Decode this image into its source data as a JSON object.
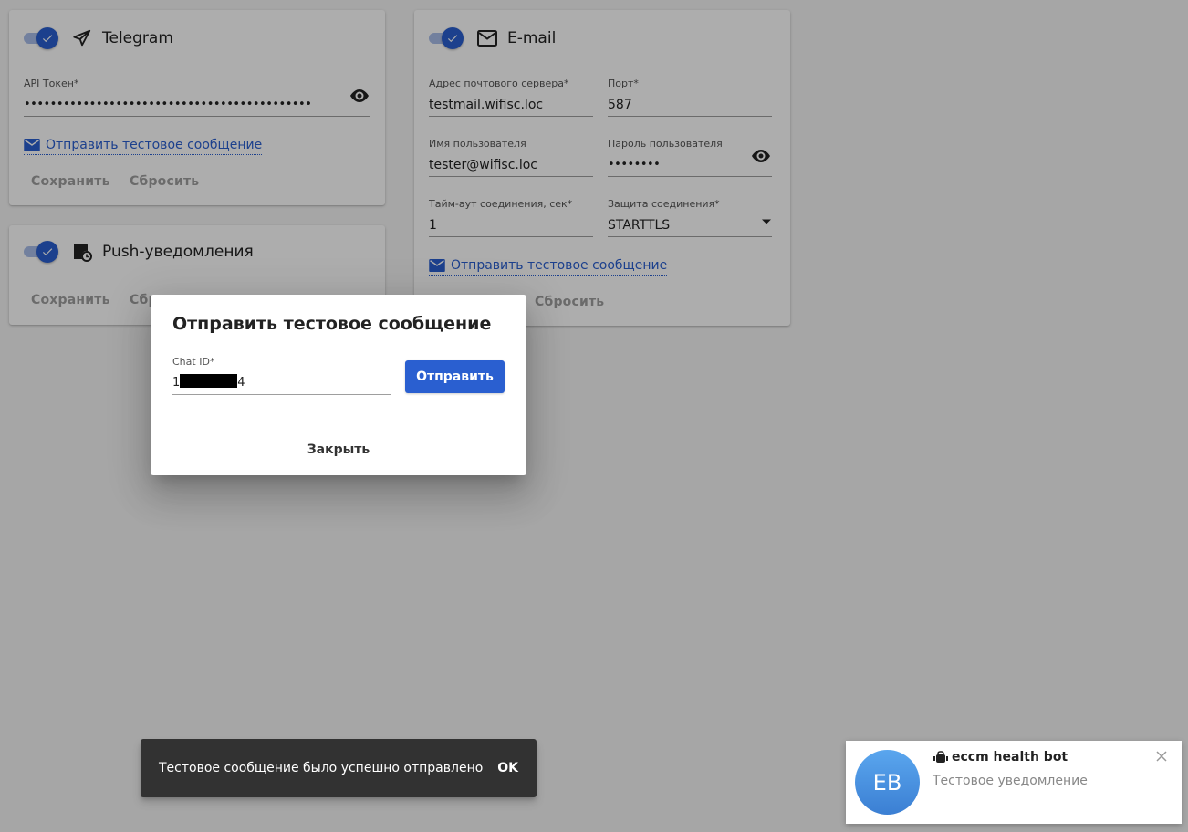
{
  "telegram": {
    "title": "Telegram",
    "icon": "send-icon",
    "enabled": true,
    "api_token_label": "API Токен*",
    "api_token_value": "••••••••••••••••••••••••••••••••••••••••••••",
    "test_link": "Отправить тестовое сообщение",
    "save": "Сохранить",
    "reset": "Сбросить"
  },
  "push": {
    "title": "Push-уведомления",
    "icon": "push-notification-icon",
    "enabled": true,
    "save": "Сохранить",
    "reset": "Сбро"
  },
  "email": {
    "title": "E-mail",
    "icon": "mail-icon",
    "enabled": true,
    "server_label": "Адрес почтового сервера*",
    "server_value": "testmail.wifisc.loc",
    "port_label": "Порт*",
    "port_value": "587",
    "user_label": "Имя пользователя",
    "user_value": "tester@wifisc.loc",
    "password_label": "Пароль пользователя",
    "password_value": "••••••••",
    "timeout_label": "Тайм-аут соединения, сек*",
    "timeout_value": "1",
    "security_label": "Защита соединения*",
    "security_value": "STARTTLS",
    "test_link": "Отправить тестовое сообщение",
    "reset": "Сбросить"
  },
  "dialog": {
    "title": "Отправить тестовое сообщение",
    "chat_id_label": "Chat ID*",
    "chat_id_prefix": "1",
    "chat_id_suffix": "4",
    "send": "Отправить",
    "close": "Закрыть"
  },
  "snackbar": {
    "message": "Тестовое сообщение было успешно отправлено",
    "action": "OK"
  },
  "notification": {
    "avatar": "EB",
    "title": "eccm health bot",
    "body": "Тестовое уведомление"
  },
  "colors": {
    "accent": "#2a5fd0",
    "snackbar_bg": "#323232",
    "avatar": "#4a90e2"
  }
}
